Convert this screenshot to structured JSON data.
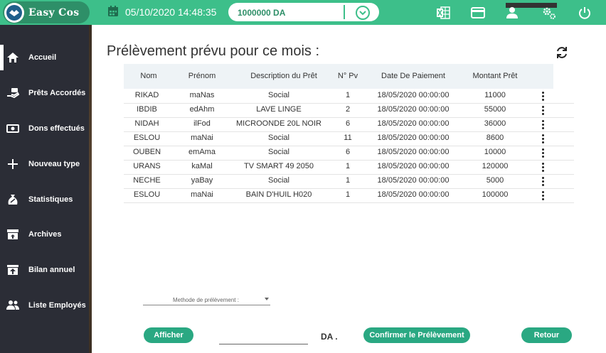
{
  "app": {
    "name": "Easy Cos"
  },
  "header": {
    "datetime": "05/10/2020 14:48:35",
    "balance": "1000000 DA"
  },
  "sidebar": {
    "items": [
      {
        "label": "Accueil",
        "icon": "home-icon"
      },
      {
        "label": "Prêts Accordés",
        "icon": "hand-money-icon"
      },
      {
        "label": "Dons effectués",
        "icon": "banknote-icon"
      },
      {
        "label": "Nouveau type",
        "icon": "plus-icon"
      },
      {
        "label": "Statistiques",
        "icon": "money-bag-icon"
      },
      {
        "label": "Archives",
        "icon": "archive-icon"
      },
      {
        "label": "Bilan annuel",
        "icon": "upload-box-icon"
      },
      {
        "label": "Liste Employés",
        "icon": "people-icon"
      }
    ]
  },
  "main": {
    "title": "Prélèvement prévu pour ce mois :",
    "table": {
      "headers": [
        "Nom",
        "Prénom",
        "Description du Prêt",
        "N° Pv",
        "Date De Paiement",
        "Montant Prêt"
      ],
      "rows": [
        [
          "RIKAD",
          "maNas",
          "Social",
          "1",
          "18/05/2020 00:00:00",
          "11000"
        ],
        [
          "IBDIB",
          "edAhm",
          "LAVE LINGE",
          "2",
          "18/05/2020 00:00:00",
          "55000"
        ],
        [
          "NIDAH",
          "ilFod",
          "MICROONDE 20L NOIR",
          "6",
          "18/05/2020 00:00:00",
          "36000"
        ],
        [
          "ESLOU",
          "maNai",
          "Social",
          "11",
          "18/05/2020 00:00:00",
          "8600"
        ],
        [
          "OUBEN",
          "emAma",
          "Social",
          "6",
          "18/05/2020 00:00:00",
          "10000"
        ],
        [
          "URANS",
          "kaMal",
          "TV SMART 49 2050",
          "1",
          "18/05/2020 00:00:00",
          "120000"
        ],
        [
          "NECHE",
          "yaBay",
          "Social",
          "1",
          "18/05/2020 00:00:00",
          "5000"
        ],
        [
          "ESLOU",
          "maNai",
          "BAIN D'HUIL H020",
          "1",
          "18/05/2020 00:00:00",
          "100000"
        ]
      ]
    },
    "method_select_label": "Methode de prélèvement :",
    "buttons": {
      "afficher": "Afficher",
      "confirmer": "Confirmer le Prélèvement",
      "retour": "Retour"
    },
    "amount_value": "",
    "currency": "DA ."
  },
  "colors": {
    "accent": "#3dbf8a",
    "button": "#2aa882",
    "sidebar": "#2b2d36"
  }
}
